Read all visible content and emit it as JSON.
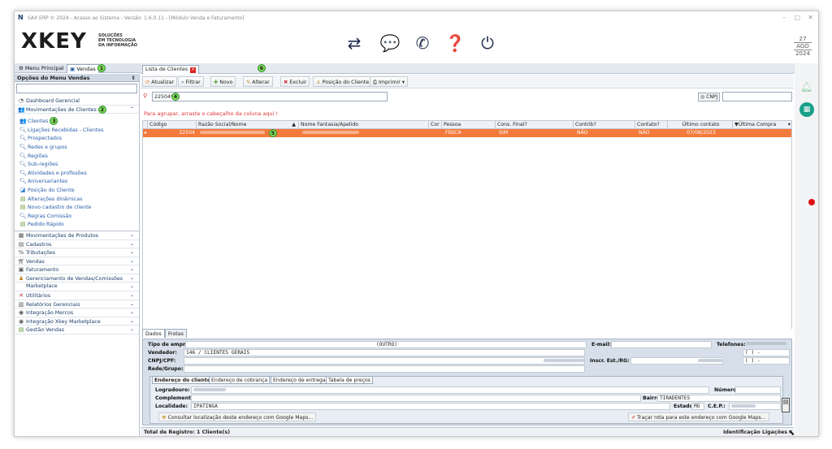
{
  "window": {
    "title": "SAX ERP © 2024 - Acesso ao Sistema - Versão: 1.6.0.11 - [Módulo Venda e Faturamento]",
    "controls": [
      "–",
      "▢",
      "✕"
    ]
  },
  "logo": {
    "text": "XKEY",
    "tagline_1": "SOLUÇÕES",
    "tagline_2": "EM TECNOLOGIA",
    "tagline_3": "DA INFORMAÇÃO"
  },
  "header_icons": [
    "shuffle-icon",
    "chat-icon",
    "whatsapp-icon",
    "help-icon",
    "power-icon"
  ],
  "date": {
    "day": "27",
    "month": "AGO",
    "year": "2024"
  },
  "menubar": {
    "main_menu": "Menu Principal",
    "sales_tab": "Vendas",
    "sales_badge": "1"
  },
  "sidebar": {
    "title": "Opções do Menu Vendas",
    "dashboard": "Dashboard Gerencial",
    "client_movements": {
      "label": "Movimentações de Clientes",
      "badge": "2"
    },
    "items": [
      {
        "label": "Clientes",
        "badge": "3"
      },
      {
        "label": "Ligações Recebidas - Clientes"
      },
      {
        "label": "Prospectados"
      },
      {
        "label": "Redes e grupos"
      },
      {
        "label": "Regiões"
      },
      {
        "label": "Sub-regiões"
      },
      {
        "label": "Atividades e profissões"
      },
      {
        "label": "Aniversariantes"
      },
      {
        "label": "Posição do Cliente"
      },
      {
        "label": "Alterações dinâmicas"
      },
      {
        "label": "Novo cadastro de cliente"
      },
      {
        "label": "Regras Comissão"
      },
      {
        "label": "Pedido Rápido"
      }
    ],
    "groups": [
      "Movimentações de Produtos",
      "Cadastros",
      "Tributações",
      "Vendas",
      "Faturamento",
      "Gerenciamento de Vendas/Comissões",
      "Marketplace",
      "Utilitários",
      "Relatórios Gerenciais",
      "Integração Mercos",
      "Integração Xkey Marketplace",
      "Gestão Vendas"
    ]
  },
  "main": {
    "tab": {
      "label": "Lista de Clientes",
      "badge": "6"
    },
    "toolbar": {
      "refresh": "Atualizar",
      "filter": "Filtrar",
      "new": "Novo",
      "edit": "Alterar",
      "delete": "Excluir",
      "client_position": "Posição do Cliente",
      "print": "Imprimir"
    },
    "search_value": "22504*",
    "search_badge": "4",
    "cnpj_label": "CNPJ",
    "group_hint": "Para agrupar, arraste o cabeçalho da coluna aqui !",
    "columns": [
      "Código",
      "Razão Social/Nome",
      "Nome Fantasia/Apelido",
      "Cor",
      "Pessoa",
      "Cons. Final?",
      "Contrib?",
      "Contato?",
      "Último contato",
      "Última Compra"
    ],
    "row": {
      "code": "22504",
      "badge": "5",
      "pessoa": "FÍSICA",
      "cons_final": "SIM",
      "contrib": "NÃO",
      "contato": "NÃO",
      "ultimo_contato": "07/08/2023",
      "ultima_compra": ""
    }
  },
  "detail": {
    "tabs": [
      "Dados",
      "Frotas"
    ],
    "tipo_label": "Tipo de empr.:",
    "tipo_value": "(OUTRO)",
    "email_label": "E-mail:",
    "telefones_label": "Telefones:",
    "vendedor_label": "Vendedor:",
    "vendedor_value": "146 / CLIENTES GERAIS",
    "cnpj_label": "CNPJ/CPF:",
    "ie_label": "Inscr. Est./RG:",
    "rede_label": "Rede/Grupo:",
    "phone_1": "(    )      -",
    "phone_2": "(    )      -",
    "address_tabs": [
      "Endereço do cliente",
      "Endereço de cobrança",
      "Endereço de entrega",
      "Tabela de preços"
    ],
    "logradouro_label": "Logradouro:",
    "numero_label": "Número:",
    "complemento_label": "Complemento:",
    "bairro_label": "Bairro:",
    "bairro_value": "TIRADENTES",
    "localidade_label": "Localidade:",
    "localidade_value": "IPATINGA",
    "estado_label": "Estado:",
    "estado_value": "MG",
    "cep_label": "C.E.P.:",
    "maps_button": "Consultar localização deste endereço com Google Maps...",
    "route_button": "Traçar rota para este endereço com Google Maps..."
  },
  "status": {
    "total": "Total de Registro: 1 Cliente(s)",
    "id_calls": "Identificação Ligações"
  },
  "colors": {
    "selected_row": "#f37a3c",
    "badge": "#7ed957",
    "accent": "#1b3d6b"
  }
}
